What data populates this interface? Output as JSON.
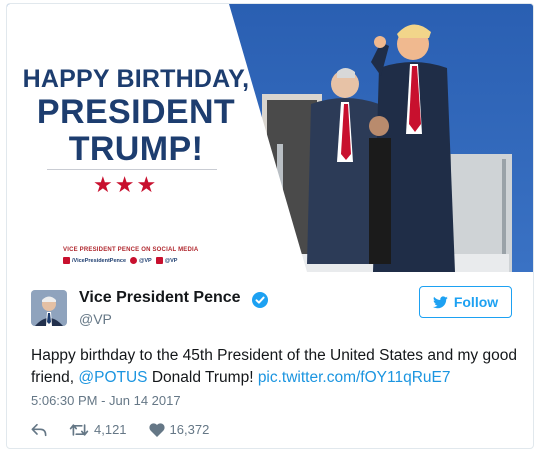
{
  "media": {
    "headline_line1": "HAPPY BIRTHDAY,",
    "headline_line2": "PRESIDENT",
    "headline_line3": "TRUMP!",
    "stars": "★★★",
    "footer_tag": "VICE PRESIDENT PENCE ON SOCIAL MEDIA",
    "social": {
      "facebook": "/VicePresidentPence",
      "twitter": "@VP",
      "instagram": "@VP"
    },
    "colors": {
      "navy": "#1d3d6f",
      "red": "#c8102e",
      "sky": "#2f63b5"
    }
  },
  "tweet": {
    "author_name": "Vice President Pence",
    "author_handle": "@VP",
    "follow_label": "Follow",
    "text_before": "Happy birthday to the 45th President of the United States and my good friend, ",
    "mention": "@POTUS",
    "text_middle": " Donald Trump! ",
    "pic_link": "pic.twitter.com/fOY11qRuE7",
    "timestamp": "5:06:30 PM - Jun 14 2017",
    "retweets": "4,121",
    "likes": "16,372",
    "accent": "#1da1f2"
  },
  "icons": {
    "reply": "reply-icon",
    "retweet": "retweet-icon",
    "like": "heart-icon",
    "verified": "verified-badge-icon",
    "follow": "twitter-bird-icon"
  }
}
